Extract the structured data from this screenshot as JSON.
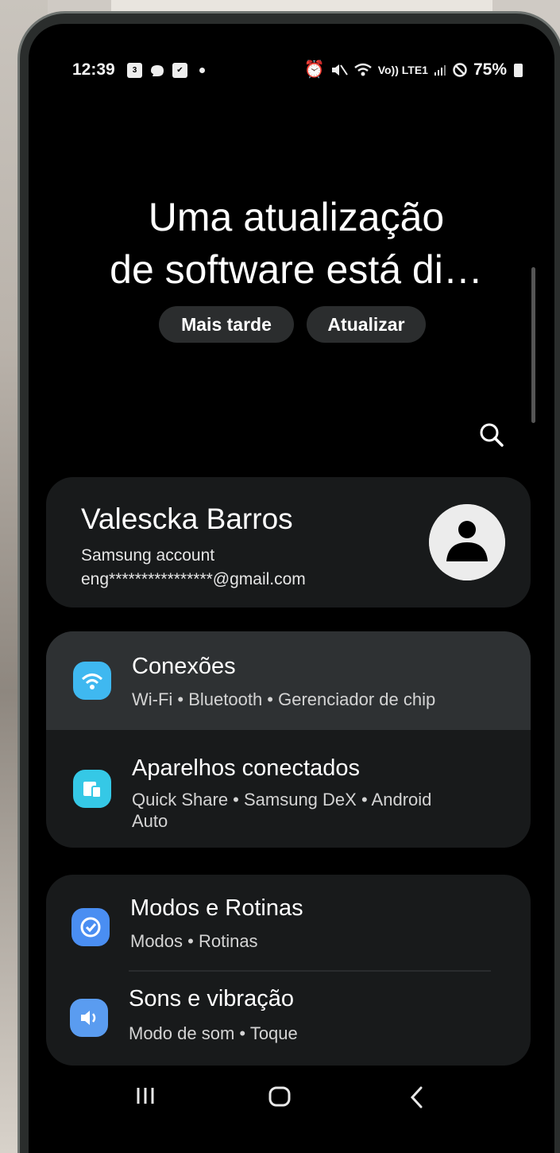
{
  "status_bar": {
    "time": "12:39",
    "network": "Vo)) LTE1",
    "battery": "75%"
  },
  "update_banner": {
    "line1": "Uma atualização",
    "line2": "de software está di…",
    "later_label": "Mais tarde",
    "update_label": "Atualizar"
  },
  "account": {
    "name": "Valescka Barros",
    "provider": "Samsung account",
    "email": "eng****************@gmail.com"
  },
  "settings": {
    "connections": {
      "title": "Conexões",
      "subtitle": "Wi-Fi  •  Bluetooth  •  Gerenciador de chip"
    },
    "connected_devices": {
      "title": "Aparelhos conectados",
      "subtitle_line1": "Quick Share  •  Samsung DeX  •  Android",
      "subtitle_line2": "Auto"
    },
    "modes_routines": {
      "title": "Modos e Rotinas",
      "subtitle": "Modos  •  Rotinas"
    },
    "sounds": {
      "title": "Sons e vibração",
      "subtitle": "Modo de som  •  Toque"
    }
  },
  "colors": {
    "connections_icon": "#3fb8f0",
    "devices_icon": "#35c8e6",
    "modes_icon": "#4a8ef2",
    "sounds_icon": "#5a9cf0",
    "active_row": "#2e3133",
    "card": "#181a1b"
  },
  "icons": {
    "wifi": "wifi-icon",
    "devices": "connected-devices-icon",
    "modes": "modes-routines-icon",
    "sounds": "speaker-icon",
    "search": "search-icon",
    "avatar": "user-avatar-icon"
  }
}
